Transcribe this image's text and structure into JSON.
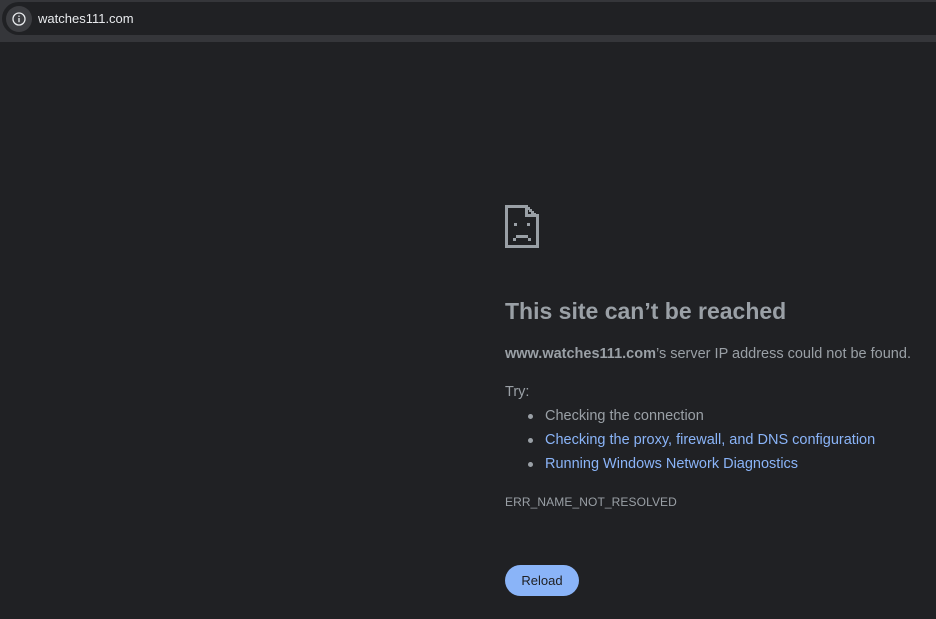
{
  "browser": {
    "url": "watches111.com",
    "site_info_icon": "info-icon"
  },
  "error_page": {
    "icon": "sad-page-icon",
    "title": "This site can’t be reached",
    "message_host": "www.watches111.com",
    "message_suffix": "’s server IP address could not be found.",
    "try_label": "Try:",
    "suggestions": [
      {
        "label": "Checking the connection",
        "is_link": false
      },
      {
        "label": "Checking the proxy, firewall, and DNS configuration",
        "is_link": true
      },
      {
        "label": "Running Windows Network Diagnostics",
        "is_link": true
      }
    ],
    "error_code": "ERR_NAME_NOT_RESOLVED",
    "reload_label": "Reload"
  },
  "colors": {
    "background": "#202124",
    "text": "#9aa0a6",
    "link": "#8ab4f8",
    "button_bg": "#8ab4f8"
  }
}
